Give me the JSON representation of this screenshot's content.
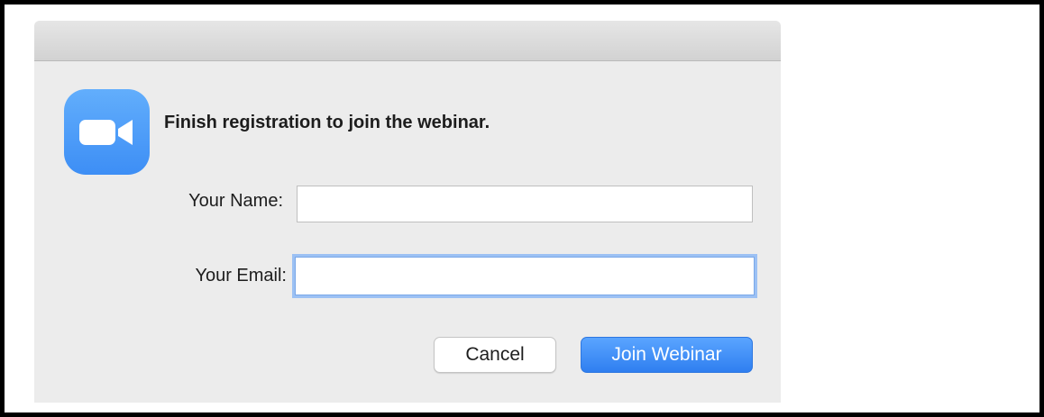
{
  "dialog": {
    "heading": "Finish registration to join the webinar.",
    "icon": "zoom-video-camera-icon",
    "accent_color": "#2d8cff"
  },
  "form": {
    "name_label": "Your Name:",
    "name_value": "",
    "email_label": "Your Email:",
    "email_value": ""
  },
  "buttons": {
    "cancel_label": "Cancel",
    "join_label": "Join Webinar"
  }
}
